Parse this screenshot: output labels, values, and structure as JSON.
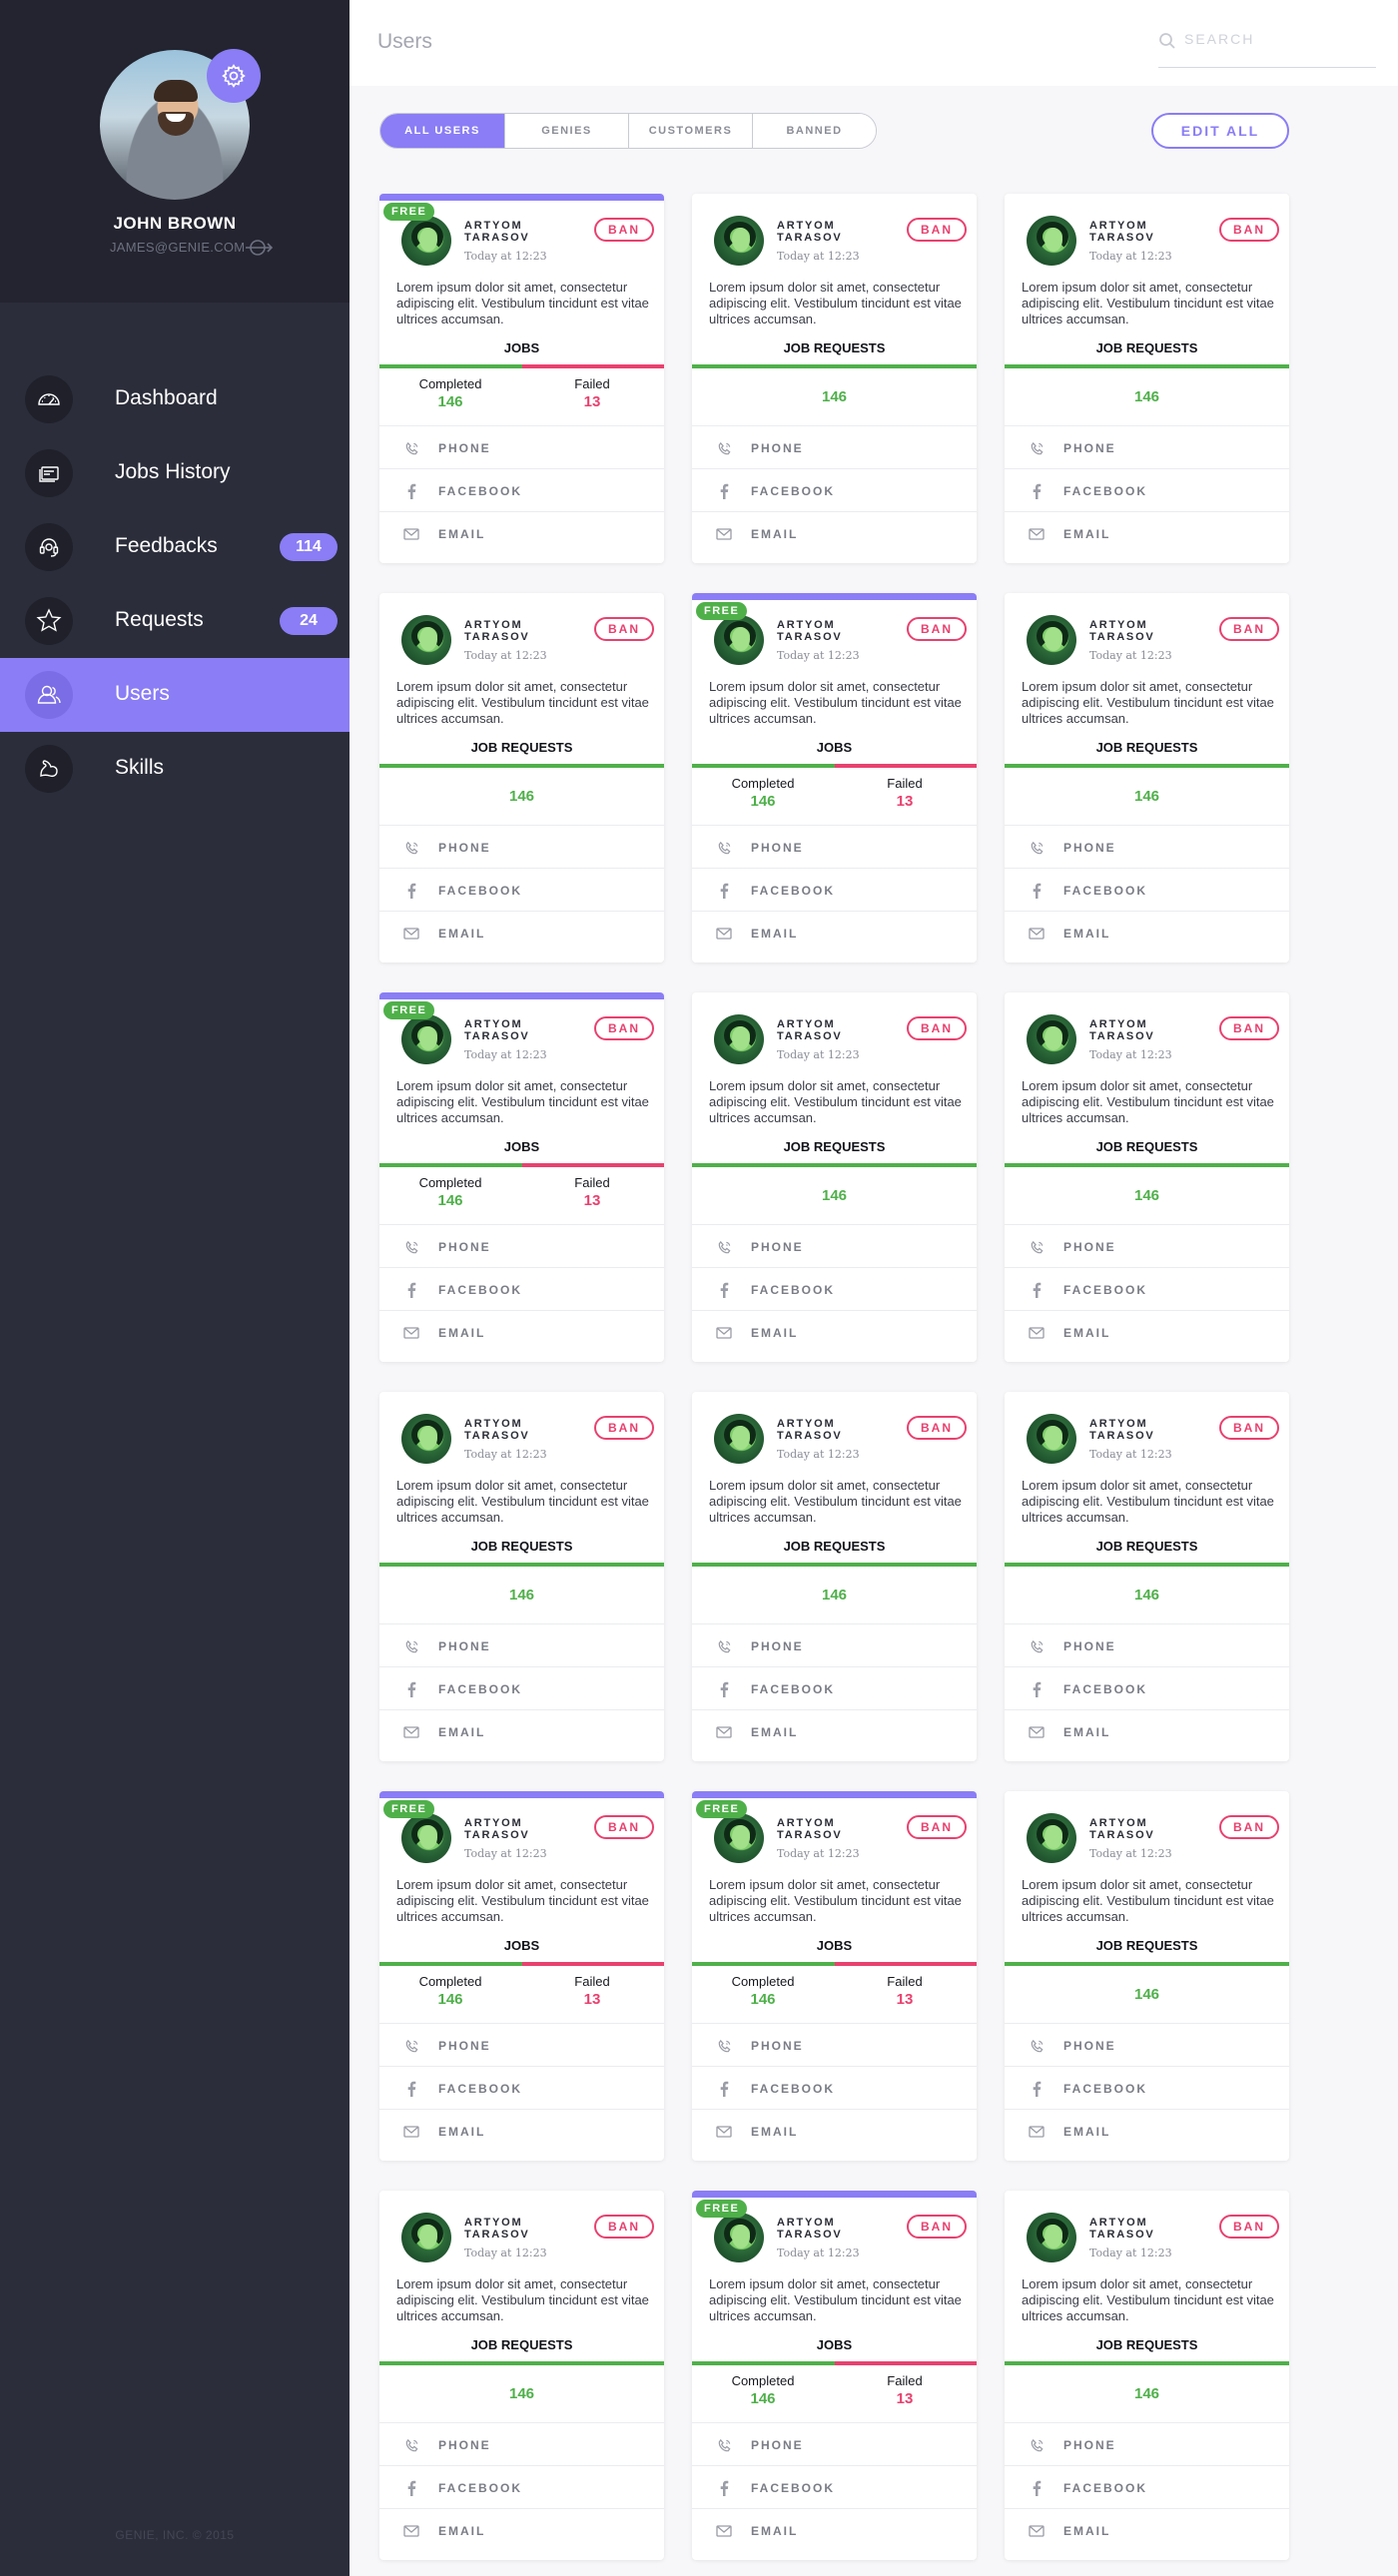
{
  "sidebar": {
    "profile": {
      "name": "JOHN BROWN",
      "email": "JAMES@GENIE.COM"
    },
    "nav": [
      {
        "label": "Dashboard",
        "icon": "gauge-icon"
      },
      {
        "label": "Jobs History",
        "icon": "history-icon"
      },
      {
        "label": "Feedbacks",
        "icon": "headset-icon",
        "badge": "114"
      },
      {
        "label": "Requests",
        "icon": "star-icon",
        "badge": "24"
      },
      {
        "label": "Users",
        "icon": "users-icon",
        "active": true
      },
      {
        "label": "Skills",
        "icon": "muscle-icon"
      }
    ],
    "footer": "GENIE, INC. © 2015"
  },
  "header": {
    "title": "Users",
    "search_placeholder": "SEARCH"
  },
  "filters": [
    "ALL USERS",
    "GENIES",
    "CUSTOMERS",
    "BANNED"
  ],
  "active_filter": "ALL USERS",
  "edit_all": "EDIT ALL",
  "card_common": {
    "name": "ARTYOM TARASOV",
    "time": "Today at 12:23",
    "ban": "BAN",
    "free_label": "FREE",
    "description": "Lorem ipsum dolor sit amet, consectetur adipiscing elit. Vestibulum tincidunt est vitae ultrices accumsan.",
    "jobs_title": "JOBS",
    "requests_title": "JOB REQUESTS",
    "completed_label": "Completed",
    "failed_label": "Failed",
    "completed": "146",
    "failed": "13",
    "requests_value": "146",
    "contacts": [
      {
        "label": "PHONE",
        "icon": "phone-icon"
      },
      {
        "label": "FACEBOOK",
        "icon": "facebook-icon"
      },
      {
        "label": "EMAIL",
        "icon": "envelope-icon"
      }
    ]
  },
  "cards": [
    {
      "free": true
    },
    {
      "free": false
    },
    {
      "free": false
    },
    {
      "free": false
    },
    {
      "free": true
    },
    {
      "free": false
    },
    {
      "free": true
    },
    {
      "free": false
    },
    {
      "free": false
    },
    {
      "free": false
    },
    {
      "free": false
    },
    {
      "free": false
    },
    {
      "free": true
    },
    {
      "free": true
    },
    {
      "free": false
    },
    {
      "free": false
    },
    {
      "free": true
    },
    {
      "free": false
    }
  ],
  "colors": {
    "accent": "#8a7df5",
    "success": "#4fb04a",
    "danger": "#e8416f",
    "sidebar": "#2b2d3a"
  }
}
